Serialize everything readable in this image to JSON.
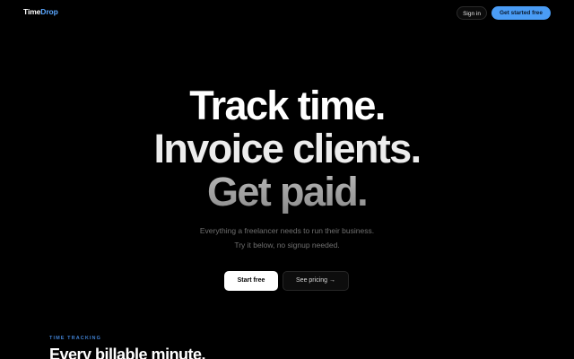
{
  "header": {
    "logo_part1": "Time",
    "logo_part2": "Drop",
    "signin_label": "Sign in",
    "get_started_label": "Get started free"
  },
  "hero": {
    "line1": "Track time.",
    "line2": "Invoice clients.",
    "line3": "Get paid.",
    "subtext_line1": "Everything a freelancer needs to run their business.",
    "subtext_line2": "Try it below, no signup needed.",
    "start_label": "Start free",
    "pricing_label": "See pricing →"
  },
  "next_section": {
    "eyebrow": "TIME TRACKING",
    "heading": "Every billable minute."
  },
  "colors": {
    "background": "#000000",
    "accent": "#4a9cf5",
    "logo_accent": "#5aa7ff",
    "eyebrow": "#3f7fcf"
  }
}
